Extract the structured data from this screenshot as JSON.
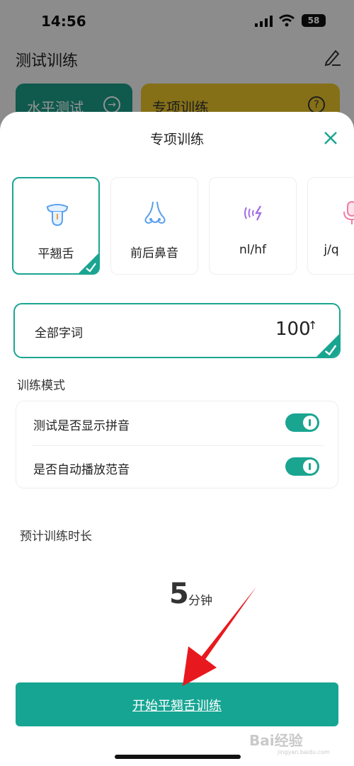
{
  "status": {
    "time": "14:56",
    "battery": "58"
  },
  "background": {
    "title": "测试训练",
    "card_level": "水平测试",
    "card_special": "专项训练"
  },
  "sheet": {
    "title": "专项训练",
    "categories": [
      {
        "label": "平翘舌",
        "icon": "tongue-icon",
        "selected": true
      },
      {
        "label": "前后鼻音",
        "icon": "nose-icon",
        "selected": false
      },
      {
        "label": "nl/hf",
        "icon": "sound-wave-icon",
        "selected": false
      },
      {
        "label": "j/q",
        "icon": "microphone-icon",
        "selected": false
      }
    ],
    "scope": {
      "label": "全部字词",
      "count": "100",
      "arrow": "↑"
    },
    "mode": {
      "title": "训练模式",
      "options": [
        {
          "label": "测试是否显示拼音",
          "on": true
        },
        {
          "label": "是否自动播放范音",
          "on": true
        }
      ]
    },
    "duration": {
      "title": "预计训练时长",
      "value": "5",
      "unit": "分钟"
    },
    "start_button": "开始平翘舌训练"
  },
  "watermark": {
    "main": "Bai经验",
    "sub": "jingyan.baidu.com"
  },
  "colors": {
    "accent": "#1aa591",
    "yellow": "#e6c22a",
    "annotation": "#e8191e"
  }
}
